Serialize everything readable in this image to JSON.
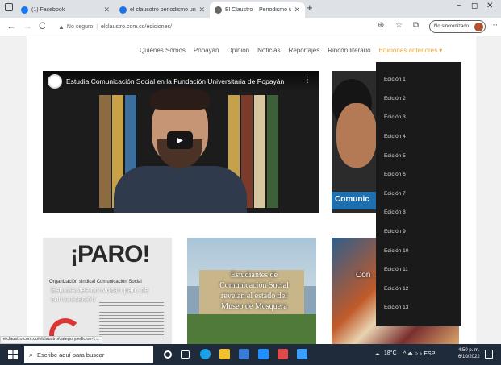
{
  "browser": {
    "tabs": [
      {
        "title": "(1) Facebook",
        "favicon_color": "#1877f2",
        "active": false
      },
      {
        "title": "el clausotro periodismo universita",
        "favicon_color": "#1a73e8",
        "active": false
      },
      {
        "title": "El Claustro – Periodismo universi",
        "favicon_color": "#666666",
        "active": true
      }
    ],
    "new_tab": "+",
    "window_controls": {
      "minimize": "−",
      "maximize": "◻",
      "close": "✕"
    },
    "back": "←",
    "forward": "→",
    "reload": "C",
    "security_label": "No seguro",
    "url": "elclaustro.com.co/ediciones/",
    "incognito_label": "No sincronizado"
  },
  "site": {
    "nav": [
      "Quiénes Somos",
      "Popayán",
      "Opinión",
      "Noticias",
      "Reportajes",
      "Rincón literario",
      "Ediciones anteriores ▾"
    ],
    "video": {
      "title": "Estudia Comunicación Social en la Fundación Universitaria de Popayán",
      "more": "⋮",
      "play": "▶"
    },
    "side_banner": "Comunic",
    "cards": [
      {
        "headline": "¡PARO!",
        "sub": "Organización sindical Comunicación Social",
        "overlay": "Estudiantes convocan paro de comunicación"
      },
      {
        "overlay": "Estudiantes de Comunicación Social revelan el estado del Museo de Mosquera"
      },
      {
        "overlay": "Con ... ... ..."
      }
    ],
    "dropdown": [
      "Edición 1",
      "Edición 2",
      "Edición 3",
      "Edición 4",
      "Edición 5",
      "Edición 6",
      "Edición 7",
      "Edición 8",
      "Edición 9",
      "Edición 10",
      "Edición 11",
      "Edición 12",
      "Edición 13"
    ],
    "status_url": "elclaustro.com.co/elclaustro/category/edicion-1..."
  },
  "taskbar": {
    "search_placeholder": "Escribe aquí para buscar",
    "weather": "18°C",
    "tray_text": "^  ⏏  ℮  ♪  ESP",
    "time": "4:50 p. m.",
    "date": "6/10/2022",
    "app_colors": [
      "#ffffff",
      "#1e90ff",
      "#f2c12e",
      "#3a7bd5",
      "#1aa1e6",
      "#e04a4a",
      "#3aa0ff"
    ]
  }
}
